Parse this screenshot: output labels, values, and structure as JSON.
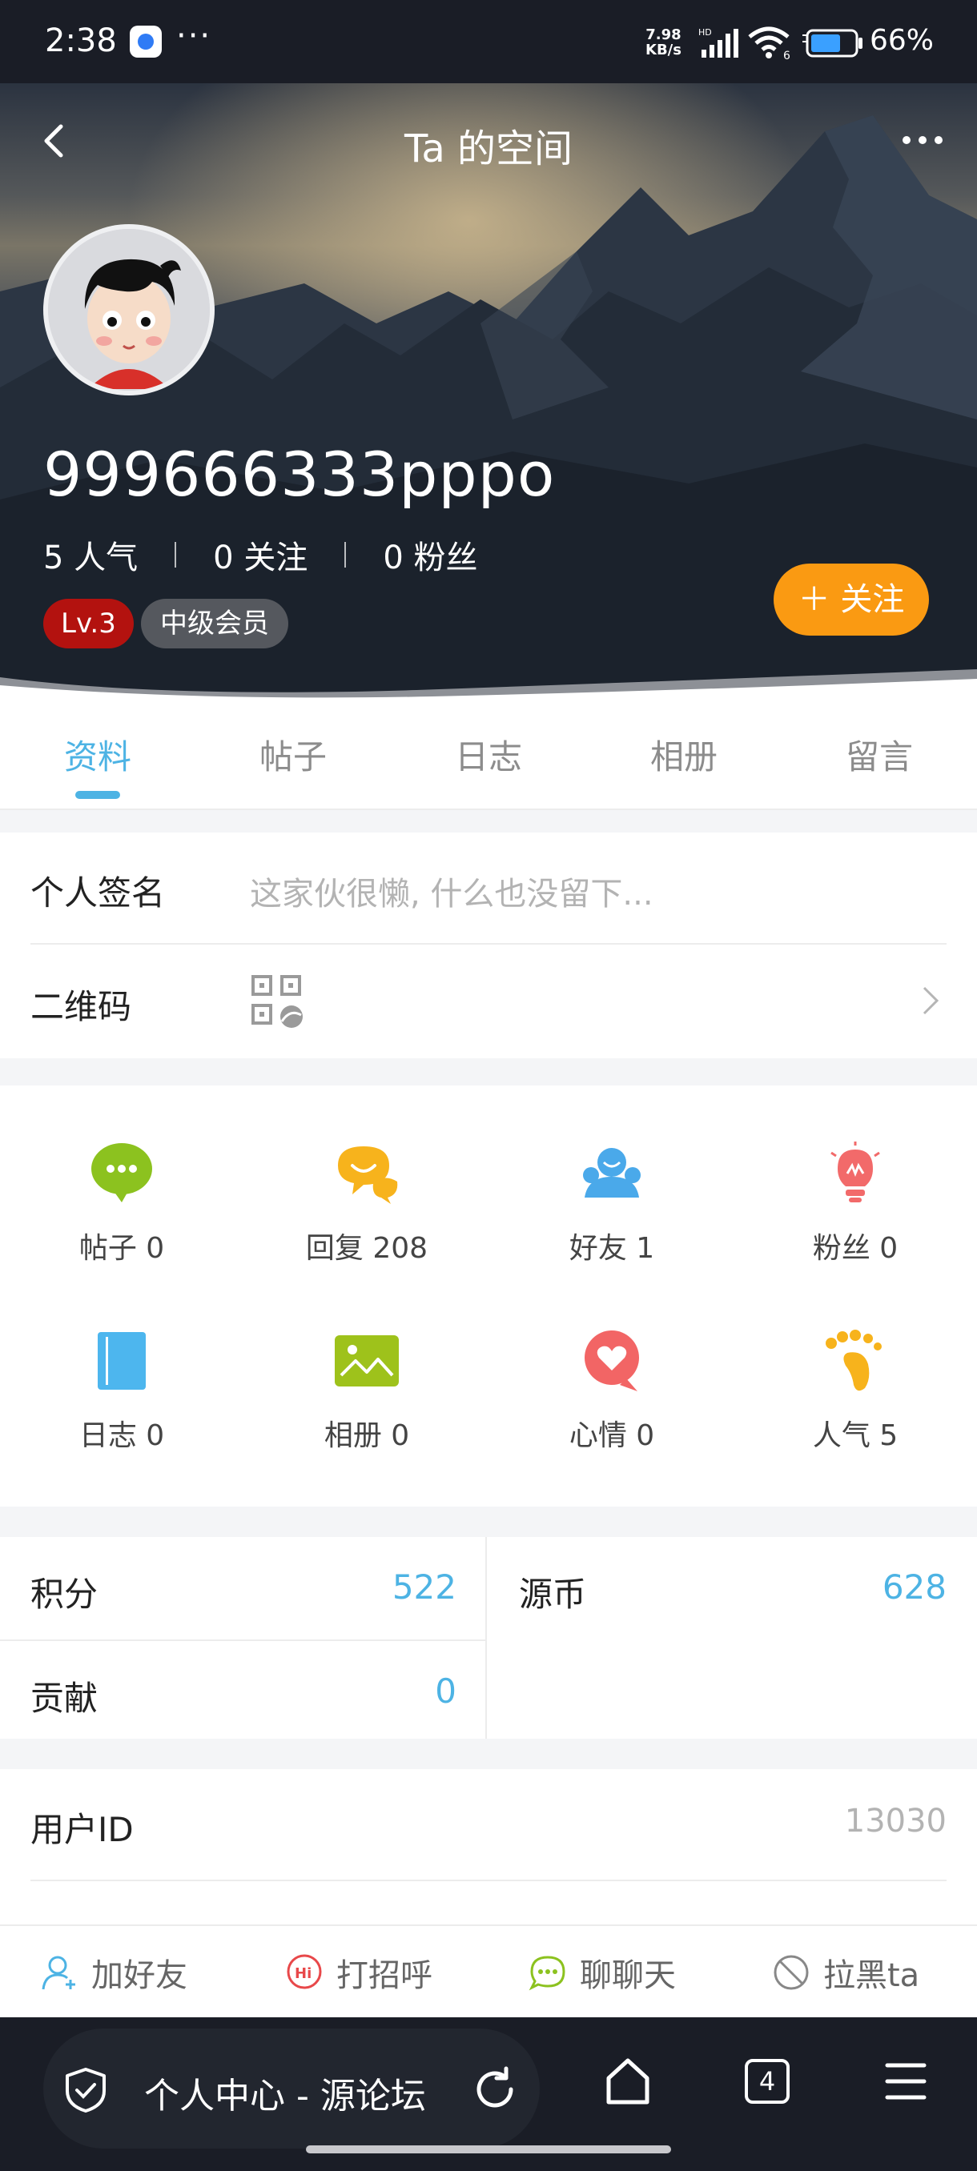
{
  "status_bar": {
    "time": "2:38",
    "more": "···",
    "net_speed_value": "7.98",
    "net_speed_unit": "KB/s",
    "network_type": "HD",
    "wifi_type": "6",
    "battery_percent": "66%"
  },
  "header": {
    "title": "Ta 的空间",
    "username": "999666333pppo",
    "popularity": "5 人气",
    "following": "0 关注",
    "fans": "0 粉丝",
    "level_badge": "Lv.3",
    "member_badge": "中级会员",
    "follow_button": "＋ 关注"
  },
  "tabs": [
    {
      "label": "资料",
      "active": true
    },
    {
      "label": "帖子",
      "active": false
    },
    {
      "label": "日志",
      "active": false
    },
    {
      "label": "相册",
      "active": false
    },
    {
      "label": "留言",
      "active": false
    }
  ],
  "profile": {
    "signature_label": "个人签名",
    "signature_value": "这家伙很懒, 什么也没留下...",
    "qrcode_label": "二维码"
  },
  "grid": [
    {
      "label": "帖子 0",
      "icon": "chat-bubble-icon",
      "color": "#8cc21f"
    },
    {
      "label": "回复 208",
      "icon": "reply-bubbles-icon",
      "color": "#f7b31c"
    },
    {
      "label": "好友 1",
      "icon": "friends-icon",
      "color": "#4aa9ea"
    },
    {
      "label": "粉丝 0",
      "icon": "lightbulb-icon",
      "color": "#f26a6a"
    },
    {
      "label": "日志 0",
      "icon": "notebook-icon",
      "color": "#4db6ee"
    },
    {
      "label": "相册 0",
      "icon": "photo-icon",
      "color": "#9ec21b"
    },
    {
      "label": "心情 0",
      "icon": "heart-bubble-icon",
      "color": "#f26565"
    },
    {
      "label": "人气 5",
      "icon": "footprint-icon",
      "color": "#f7b31c"
    }
  ],
  "points": {
    "jifen_label": "积分",
    "jifen_value": "522",
    "yuanbi_label": "源币",
    "yuanbi_value": "628",
    "gongxian_label": "贡献",
    "gongxian_value": "0"
  },
  "user_id": {
    "label": "用户ID",
    "value": "13030"
  },
  "actions": {
    "add_friend": "加好友",
    "greet": "打招呼",
    "chat": "聊聊天",
    "block": "拉黑ta",
    "greet_icon_text": "Hi"
  },
  "browser": {
    "url_title": "个人中心 - 源论坛",
    "tab_count": "4"
  }
}
